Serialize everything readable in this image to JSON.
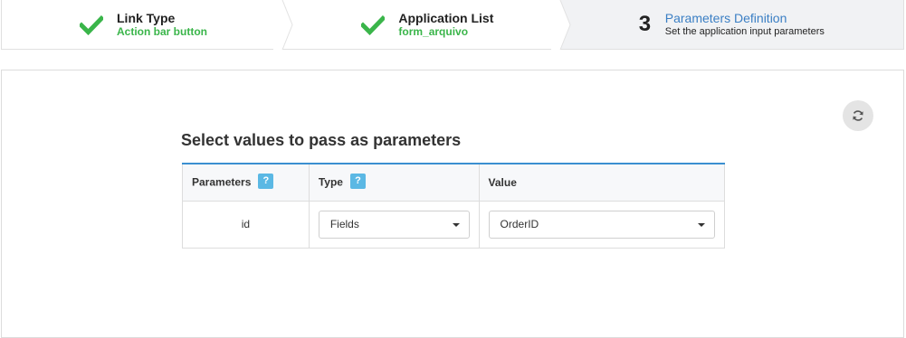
{
  "wizard": {
    "steps": [
      {
        "title": "Link Type",
        "subtitle": "Action bar button",
        "status": "completed",
        "icon": "check-icon"
      },
      {
        "title": "Application List",
        "subtitle": "form_arquivo",
        "status": "completed",
        "icon": "check-icon"
      },
      {
        "number": "3",
        "title": "Parameters Definition",
        "subtitle": "Set the application input parameters",
        "status": "active"
      }
    ]
  },
  "main": {
    "title": "Select values to pass as parameters",
    "refresh_icon": "refresh-icon",
    "table": {
      "headers": [
        {
          "label": "Parameters",
          "help": "?"
        },
        {
          "label": "Type",
          "help": "?"
        },
        {
          "label": "Value"
        }
      ],
      "rows": [
        {
          "parameter": "id",
          "type": "Fields",
          "value": "OrderID"
        }
      ]
    }
  },
  "colors": {
    "completed_green": "#3ab54a",
    "active_blue": "#3b7fc4",
    "table_accent": "#3b8fd1",
    "help_badge": "#5bb8e4"
  }
}
